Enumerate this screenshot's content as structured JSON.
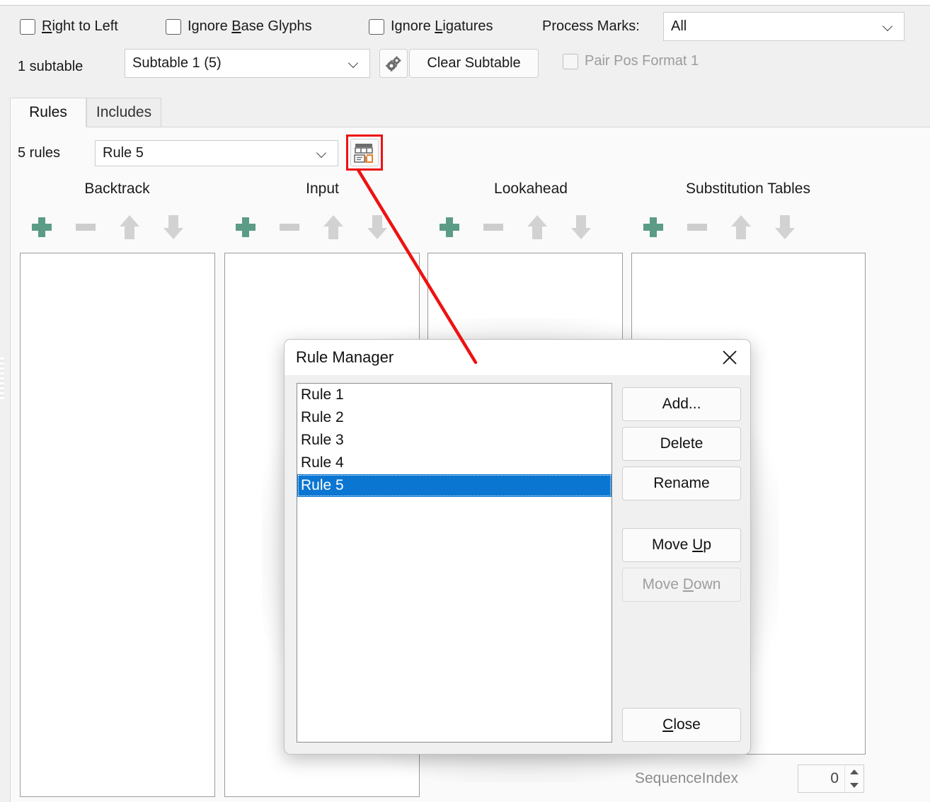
{
  "options": {
    "checkboxes": [
      {
        "name": "right-to-left",
        "label_pre": "",
        "label_accel": "R",
        "label_post": "ight to Left",
        "checked": false,
        "disabled": false
      },
      {
        "name": "ignore-base-glyphs",
        "label_pre": "Ignore ",
        "label_accel": "B",
        "label_post": "ase Glyphs",
        "checked": false,
        "disabled": false
      },
      {
        "name": "ignore-ligatures",
        "label_pre": "Ignore ",
        "label_accel": "L",
        "label_post": "igatures",
        "checked": false,
        "disabled": false
      },
      {
        "name": "pair-pos-format-1",
        "label_pre": "Pair Pos Format 1",
        "label_accel": "",
        "label_post": "",
        "checked": false,
        "disabled": true
      }
    ],
    "right_to_left_label": "Right to Left",
    "ignore_base_glyphs_label": "Ignore Base Glyphs",
    "ignore_ligatures_label": "Ignore Ligatures",
    "pair_pos_format_label": "Pair Pos Format 1",
    "process_marks_label": "Process Marks:",
    "process_marks_value": "All",
    "subtable_count_label": "1 subtable",
    "subtable_value": "Subtable 1 (5)",
    "clear_subtable_label": "Clear Subtable"
  },
  "tabs": [
    {
      "label": "Rules",
      "active": true
    },
    {
      "label": "Includes",
      "active": false
    }
  ],
  "rules": {
    "count_label": "5 rules",
    "selected_rule": "Rule 5",
    "columns": [
      {
        "title": "Backtrack"
      },
      {
        "title": "Input"
      },
      {
        "title": "Lookahead"
      },
      {
        "title": "Substitution Tables"
      }
    ],
    "sequence_index_label": "SequenceIndex",
    "sequence_index_value": "0"
  },
  "dialog": {
    "title": "Rule Manager",
    "close_icon": "close-icon",
    "items": [
      "Rule 1",
      "Rule 2",
      "Rule 3",
      "Rule 4",
      "Rule 5"
    ],
    "selected_index": 4,
    "buttons": [
      {
        "name": "add-button",
        "label": "Add...",
        "disabled": false,
        "accel": ""
      },
      {
        "name": "delete-button",
        "label": "Delete",
        "disabled": false,
        "accel": ""
      },
      {
        "name": "rename-button",
        "label": "Rename",
        "disabled": false,
        "accel": ""
      },
      {
        "name": "move-up-button",
        "label_pre": "Move ",
        "accel": "U",
        "label_post": "p",
        "label": "Move Up",
        "disabled": false
      },
      {
        "name": "move-down-button",
        "label_pre": "Move ",
        "accel": "D",
        "label_post": "own",
        "label": "Move Down",
        "disabled": true
      },
      {
        "name": "close-button",
        "label_pre": "",
        "accel": "C",
        "label_post": "lose",
        "label": "Close",
        "disabled": false
      }
    ]
  },
  "colors": {
    "accent_selection": "#0a76d2",
    "plus_green": "#5c9c87",
    "disabled_grey": "#cdcdcd",
    "annotation_red": "#ee1111",
    "icon_orange": "#e8812b",
    "icon_grey": "#6d6d6d"
  },
  "icons": {
    "gear": "gear-icon",
    "chevron_down": "chevron-down-icon",
    "plus": "plus-icon",
    "minus": "minus-icon",
    "arrow_up": "arrow-up-icon",
    "arrow_down": "arrow-down-icon",
    "rule_manager": "rule-manager-icon",
    "spin_up": "spinner-up-icon",
    "spin_down": "spinner-down-icon"
  }
}
